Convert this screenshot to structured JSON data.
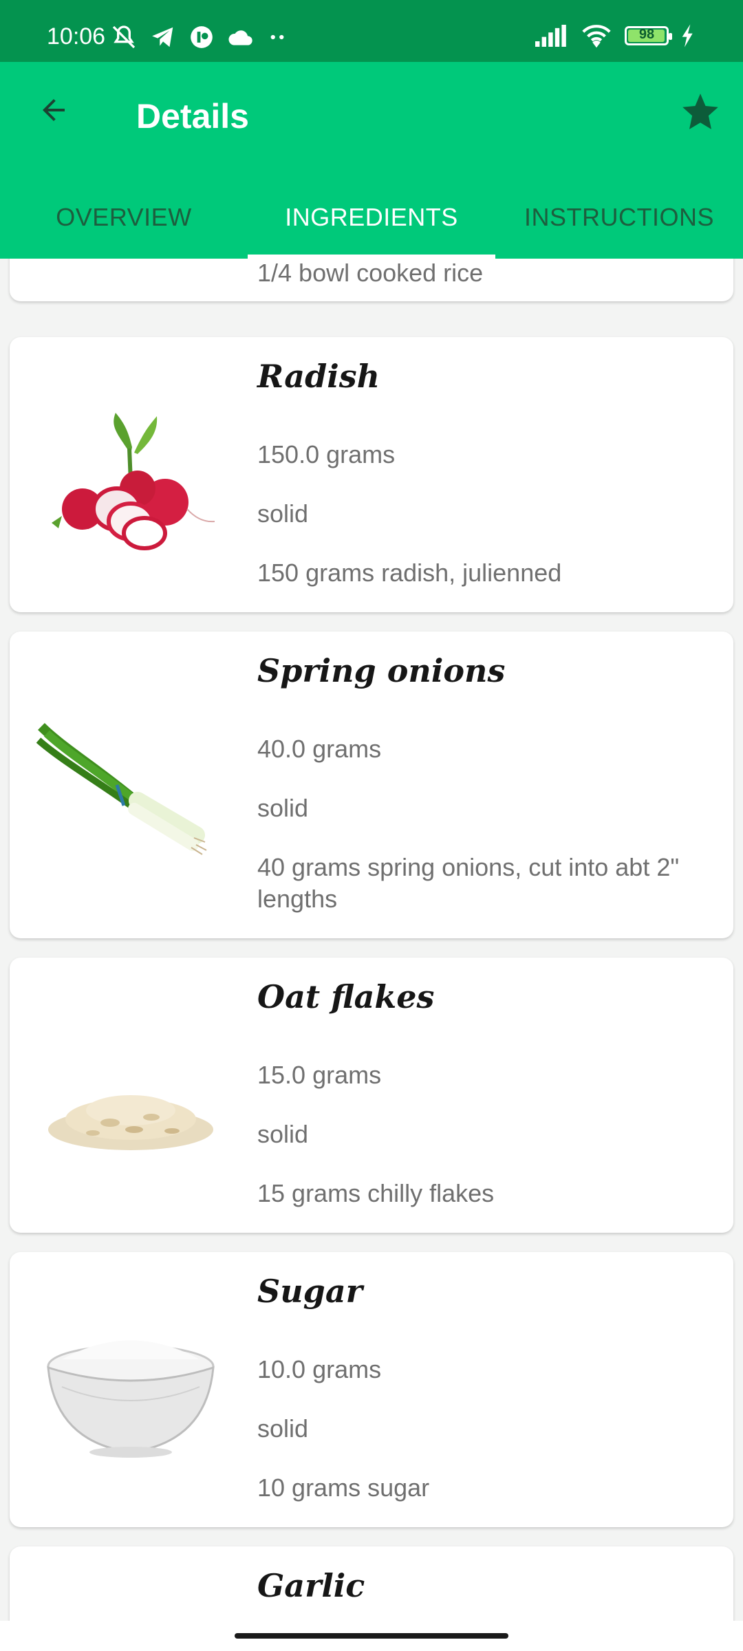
{
  "status_bar": {
    "time": "10:06",
    "battery": "98",
    "battery_level": 0.98,
    "icons": [
      "mute-bell-icon",
      "telegram-icon",
      "app-icon",
      "cloud-icon",
      "more-dots-icon",
      "signal-icon",
      "wifi-icon",
      "battery-icon",
      "charging-icon"
    ]
  },
  "app_bar": {
    "title": "Details",
    "back_icon": "arrow-left-icon",
    "star_icon": "star-icon",
    "colors": {
      "primary": "#00c97a",
      "status": "#04934f",
      "star": "#0d5c3a"
    }
  },
  "tabs": [
    {
      "label": "OVERVIEW",
      "active": false
    },
    {
      "label": "INGREDIENTS",
      "active": true
    },
    {
      "label": "INSTRUCTIONS",
      "active": false
    }
  ],
  "ingredients": {
    "partial_top": {
      "description": "1/4 bowl cooked rice"
    },
    "items": [
      {
        "name": "Radish",
        "quantity": "150.0  grams",
        "type": "solid",
        "description": "150 grams radish, julienned",
        "image": "radish-image"
      },
      {
        "name": "Spring onions",
        "quantity": "40.0  grams",
        "type": "solid",
        "description": "40 grams spring onions, cut into abt 2\" lengths",
        "image": "spring-onions-image"
      },
      {
        "name": "Oat flakes",
        "quantity": "15.0  grams",
        "type": "solid",
        "description": "15 grams chilly flakes",
        "image": "oat-flakes-image"
      },
      {
        "name": "Sugar",
        "quantity": "10.0  grams",
        "type": "solid",
        "description": "10 grams sugar",
        "image": "sugar-bowl-image"
      },
      {
        "name": "Garlic"
      }
    ]
  }
}
